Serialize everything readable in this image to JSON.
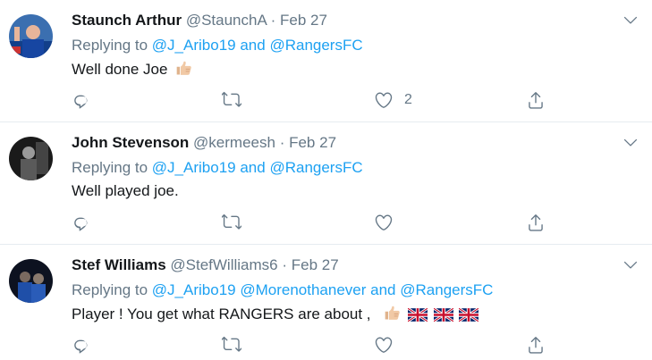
{
  "tweets": [
    {
      "name": "Staunch Arthur",
      "handle": "@StaunchA",
      "date": "Feb 27",
      "replying_prefix": "Replying to",
      "mention1": "@J_Aribo19",
      "connector": "and",
      "mention2": "@RangersFC",
      "text": "Well done Joe",
      "like_count": "2"
    },
    {
      "name": "John Stevenson",
      "handle": "@kermeesh",
      "date": "Feb 27",
      "replying_prefix": "Replying to",
      "mention1": "@J_Aribo19",
      "connector": "and",
      "mention2": "@RangersFC",
      "text": "Well played joe.",
      "like_count": ""
    },
    {
      "name": "Stef Williams",
      "handle": "@StefWilliams6",
      "date": "Feb 27",
      "replying_prefix": "Replying to",
      "mention1": "@J_Aribo19",
      "mention_mid": "@Morenothanever",
      "connector": "and",
      "mention2": "@RangersFC",
      "text": "Player ! You get what RANGERS are about ,",
      "like_count": ""
    }
  ],
  "separator": "·",
  "icons": [
    "reply-icon",
    "retweet-icon",
    "like-icon",
    "share-icon",
    "chevron-down-icon",
    "thumbs-up-emoji",
    "uk-flag-emoji"
  ],
  "colors": {
    "link": "#1da1f2",
    "secondary": "#657786",
    "border": "#e6ecf0",
    "text": "#14171a"
  }
}
